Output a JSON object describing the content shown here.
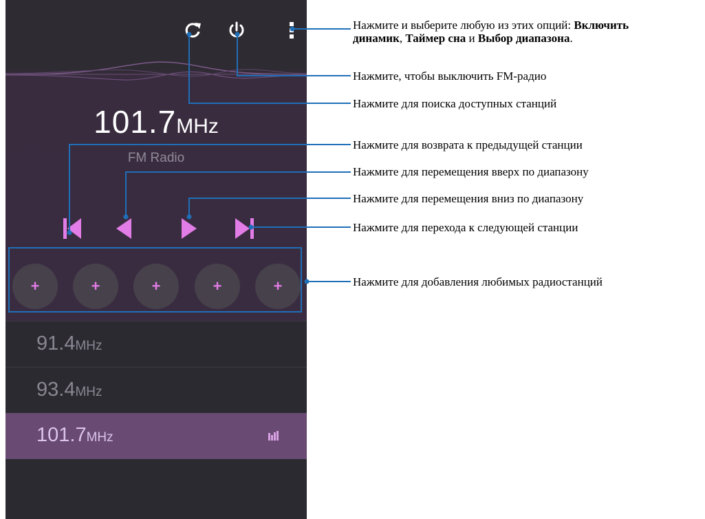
{
  "app": {
    "current": {
      "frequency": "101.7",
      "unit": "MHz",
      "band_label": "FM Radio"
    },
    "top_bar": {
      "icons": [
        "refresh-icon",
        "power-icon",
        "more-options-icon"
      ]
    },
    "controls": {
      "icons": [
        "skip-previous-icon",
        "seek-up-icon",
        "seek-down-icon",
        "skip-next-icon"
      ]
    },
    "presets": {
      "items": [
        {
          "label": "+"
        },
        {
          "label": "+"
        },
        {
          "label": "+"
        },
        {
          "label": "+"
        },
        {
          "label": "+"
        }
      ]
    },
    "stations": [
      {
        "frequency": "91.4",
        "unit": "MHz",
        "active": false
      },
      {
        "frequency": "93.4",
        "unit": "MHz",
        "active": false
      },
      {
        "frequency": "101.7",
        "unit": "MHz",
        "active": true
      }
    ],
    "colors": {
      "accent": "#e27ce6",
      "background": "#2b2a30",
      "active_row": "#684a72",
      "callout_line": "#1f6fb8"
    }
  },
  "callouts": {
    "options": {
      "prefix": "Нажмите и выберите любую из этих опций: ",
      "opt1_line1": "Включить",
      "opt1_line2": "динамик",
      "sep1": ", ",
      "opt2": "Таймер сна",
      "sep2": " и ",
      "opt3": "Выбор диапазона",
      "end": "."
    },
    "power": "Нажмите, чтобы выключить FM-радио",
    "refresh": "Нажмите для поиска доступных станций",
    "prev_station": "Нажмите для возврата к предыдущей станции",
    "seek_up": "Нажмите для перемещения вверх по диапазону",
    "seek_down": "Нажмите для перемещения вниз по диапазону",
    "next_station": "Нажмите для перехода к следующей станции",
    "favorites": "Нажмите для добавления любимых радиостанций"
  }
}
